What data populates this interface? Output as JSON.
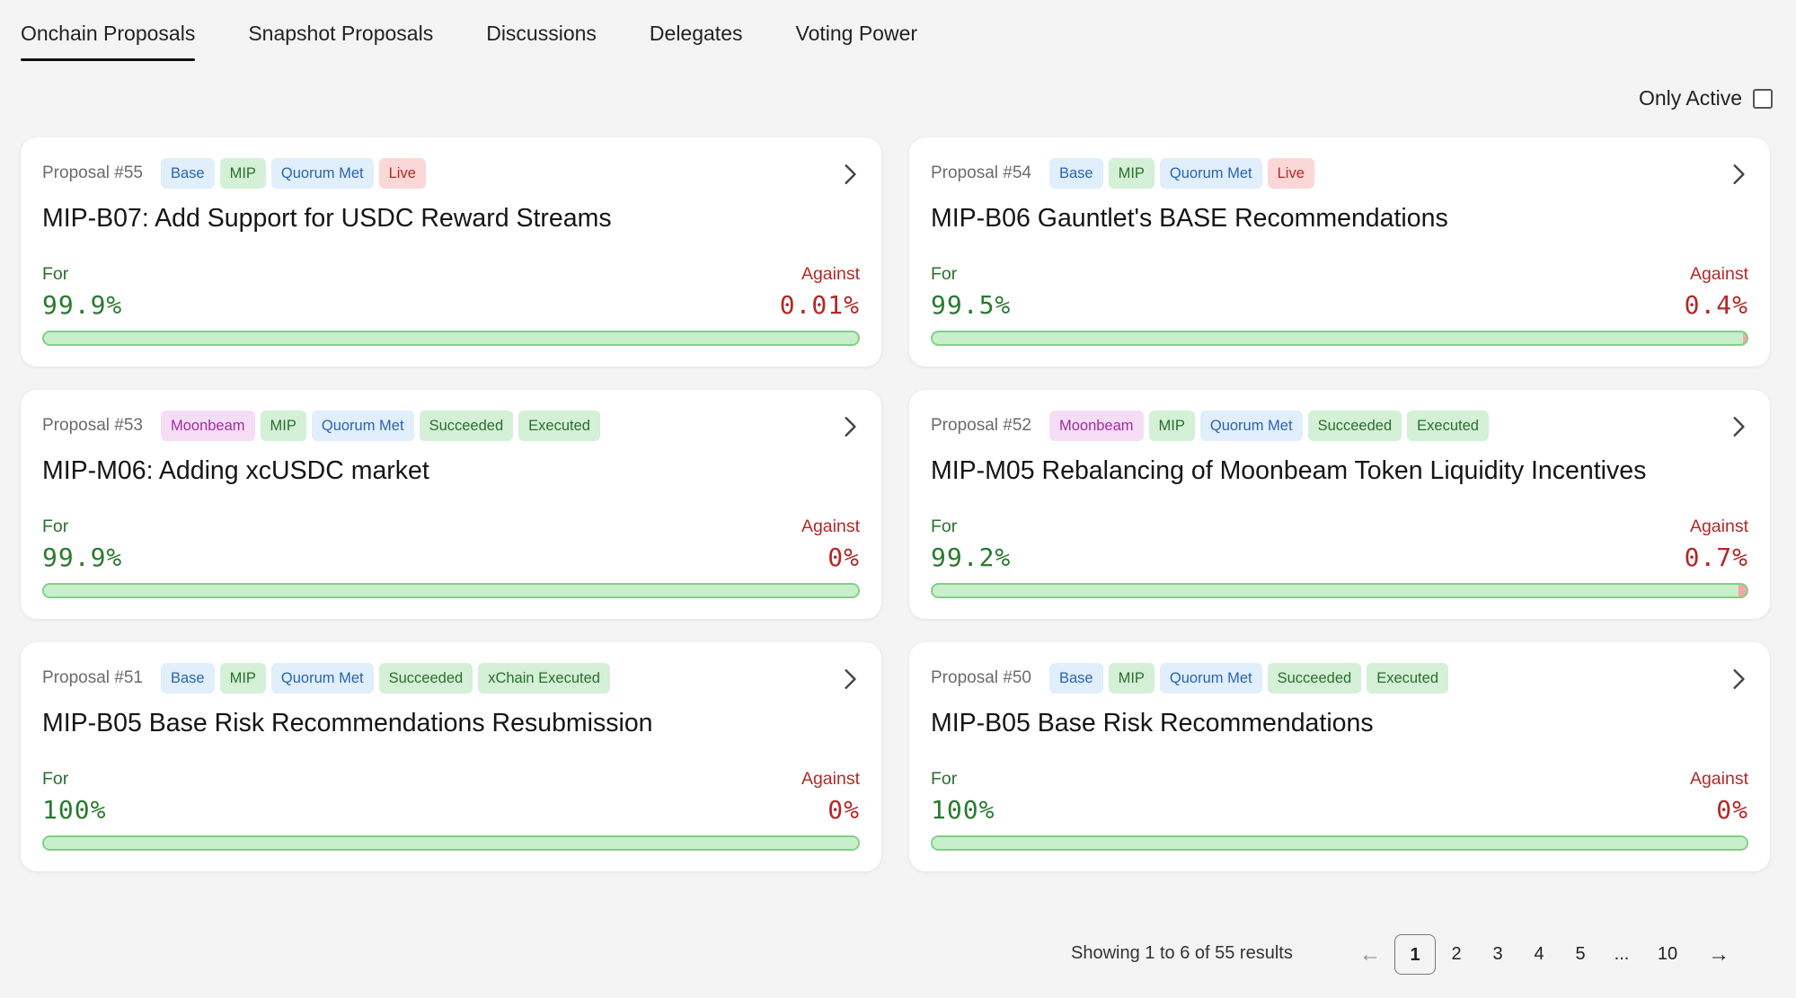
{
  "tabs": [
    {
      "label": "Onchain Proposals",
      "active": true
    },
    {
      "label": "Snapshot Proposals",
      "active": false
    },
    {
      "label": "Discussions",
      "active": false
    },
    {
      "label": "Delegates",
      "active": false
    },
    {
      "label": "Voting Power",
      "active": false
    }
  ],
  "filter": {
    "only_active_label": "Only Active",
    "checked": false
  },
  "labels": {
    "for": "For",
    "against": "Against"
  },
  "proposals": [
    {
      "number": "Proposal #55",
      "title": "MIP-B07: Add Support for USDC Reward Streams",
      "tags": [
        {
          "text": "Base",
          "color": "blue"
        },
        {
          "text": "MIP",
          "color": "green"
        },
        {
          "text": "Quorum Met",
          "color": "blue"
        },
        {
          "text": "Live",
          "color": "red"
        }
      ],
      "for_pct": "99.9%",
      "against_pct": "0.01%",
      "for_fraction": 99.99
    },
    {
      "number": "Proposal #54",
      "title": "MIP-B06 Gauntlet's BASE Recommendations",
      "tags": [
        {
          "text": "Base",
          "color": "blue"
        },
        {
          "text": "MIP",
          "color": "green"
        },
        {
          "text": "Quorum Met",
          "color": "blue"
        },
        {
          "text": "Live",
          "color": "red"
        }
      ],
      "for_pct": "99.5%",
      "against_pct": "0.4%",
      "for_fraction": 99.6
    },
    {
      "number": "Proposal #53",
      "title": "MIP-M06: Adding xcUSDC market",
      "tags": [
        {
          "text": "Moonbeam",
          "color": "purple"
        },
        {
          "text": "MIP",
          "color": "green"
        },
        {
          "text": "Quorum Met",
          "color": "blue"
        },
        {
          "text": "Succeeded",
          "color": "green"
        },
        {
          "text": "Executed",
          "color": "green"
        }
      ],
      "for_pct": "99.9%",
      "against_pct": "0%",
      "for_fraction": 100
    },
    {
      "number": "Proposal #52",
      "title": "MIP-M05 Rebalancing of Moonbeam Token Liquidity Incentives",
      "tags": [
        {
          "text": "Moonbeam",
          "color": "purple"
        },
        {
          "text": "MIP",
          "color": "green"
        },
        {
          "text": "Quorum Met",
          "color": "blue"
        },
        {
          "text": "Succeeded",
          "color": "green"
        },
        {
          "text": "Executed",
          "color": "green"
        }
      ],
      "for_pct": "99.2%",
      "against_pct": "0.7%",
      "for_fraction": 99.0
    },
    {
      "number": "Proposal #51",
      "title": "MIP-B05 Base Risk Recommendations Resubmission",
      "tags": [
        {
          "text": "Base",
          "color": "blue"
        },
        {
          "text": "MIP",
          "color": "green"
        },
        {
          "text": "Quorum Met",
          "color": "blue"
        },
        {
          "text": "Succeeded",
          "color": "green"
        },
        {
          "text": "xChain Executed",
          "color": "green"
        }
      ],
      "for_pct": "100%",
      "against_pct": "0%",
      "for_fraction": 100
    },
    {
      "number": "Proposal #50",
      "title": "MIP-B05 Base Risk Recommendations",
      "tags": [
        {
          "text": "Base",
          "color": "blue"
        },
        {
          "text": "MIP",
          "color": "green"
        },
        {
          "text": "Quorum Met",
          "color": "blue"
        },
        {
          "text": "Succeeded",
          "color": "green"
        },
        {
          "text": "Executed",
          "color": "green"
        }
      ],
      "for_pct": "100%",
      "against_pct": "0%",
      "for_fraction": 100
    }
  ],
  "pagination": {
    "summary": "Showing 1 to 6 of 55 results",
    "prev_icon": "arrow-left-icon",
    "next_icon": "arrow-right-icon",
    "pages": [
      "1",
      "2",
      "3",
      "4",
      "5",
      "...",
      "10"
    ],
    "current": "1"
  }
}
